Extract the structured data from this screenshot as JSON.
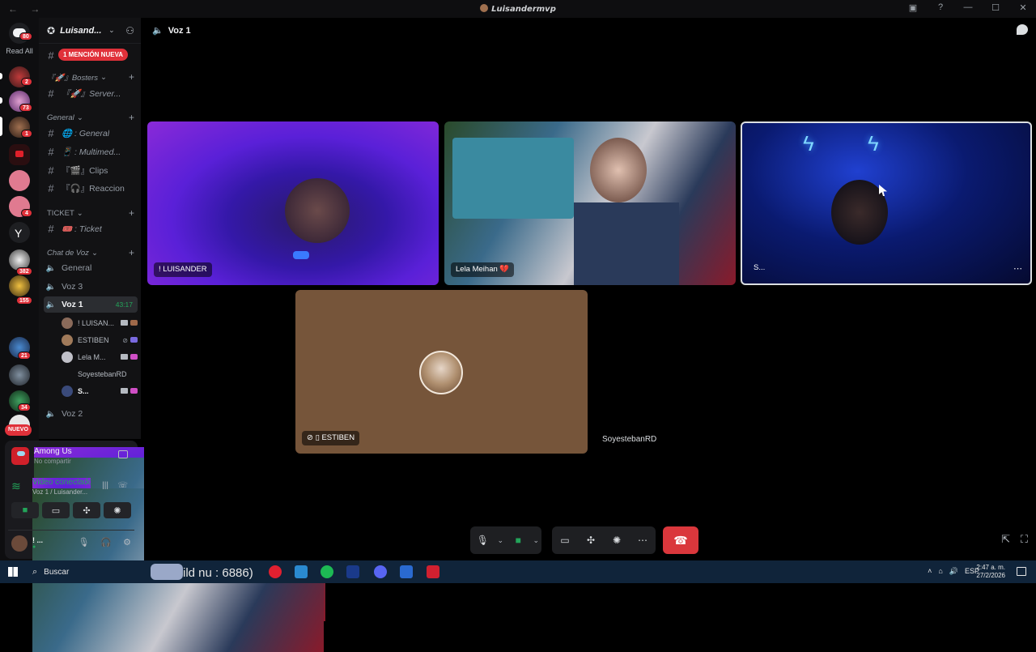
{
  "window": {
    "title": "Luisandermvp",
    "nav": "← →"
  },
  "servers": {
    "read_all": "Read All",
    "badges": [
      "80",
      "2",
      "73",
      "1",
      "4",
      "382",
      "155",
      "21",
      "34"
    ],
    "new_label": "NUEVO"
  },
  "guild": {
    "name": "Luisand..."
  },
  "channels": {
    "mention_pill": "1 MENCIÓN NUEVA",
    "cat_bosters": "『🚀』Bosters",
    "ch_server": "『🚀』Server...",
    "cat_general": "General",
    "ch_general": "🌐 : General",
    "ch_multimedia": "📱 : Multimed...",
    "ch_clips": "『🎬』Clips",
    "ch_reaccion": "『🎧』Reaccion",
    "cat_ticket": "TICKET",
    "ch_ticket": "🎟️ : Ticket",
    "cat_voz": "Chat de Voz",
    "vc_general": "General",
    "vc_voz3": "Voz 3",
    "vc_voz1": "Voz 1",
    "vc_voz1_time": "43:17",
    "vc_voz2": "Voz 2",
    "members": [
      "! LUISAN...",
      "ESTIBEN",
      "Lela M...",
      "SoyestebanRD",
      "S..."
    ]
  },
  "panel": {
    "activity_title": "Among Us",
    "activity_sub": "No compartir",
    "conn_title": "Video conectado",
    "conn_sub": "Voz 1 / Luisander...",
    "user_name": "! ...",
    "user_status": "●"
  },
  "stage": {
    "channel": "Voz 1",
    "tiles": {
      "luisander": "! LUISANDER",
      "lela": "Lela Meihan 💔",
      "s": "S...",
      "estiben": "ESTIBEN",
      "soyesteban": "SoyestebanRD"
    }
  },
  "taskbar": {
    "search": "Buscar",
    "odd_text": "ild nu : 6886)",
    "lang": "ESP",
    "time": "2:47 a. m.",
    "date": "27/2/2026"
  },
  "colors": {
    "accent_green": "#23a55a",
    "mention_red": "#e0313a",
    "end_call": "#da373c"
  }
}
